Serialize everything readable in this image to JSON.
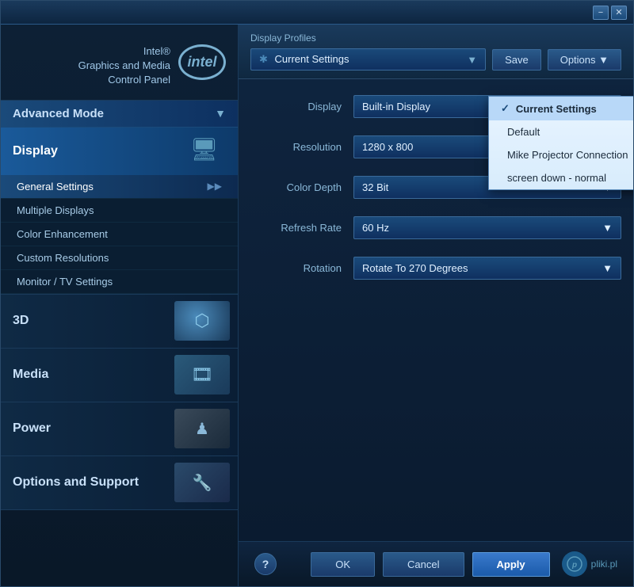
{
  "window": {
    "title": "Intel® Graphics and Media Control Panel",
    "min_btn": "−",
    "close_btn": "✕"
  },
  "sidebar": {
    "intel_label": "intel",
    "app_title_line1": "Intel®",
    "app_title_line2": "Graphics and Media",
    "app_title_line3": "Control Panel",
    "mode_label": "Advanced Mode",
    "mode_arrow": "▼",
    "sections": [
      {
        "id": "display",
        "label": "Display",
        "active": true,
        "sub_items": [
          {
            "label": "General Settings",
            "active": true,
            "has_arrow": true
          },
          {
            "label": "Multiple Displays"
          },
          {
            "label": "Color Enhancement"
          },
          {
            "label": "Custom Resolutions"
          },
          {
            "label": "Monitor / TV Settings"
          }
        ]
      },
      {
        "id": "3d",
        "label": "3D"
      },
      {
        "id": "media",
        "label": "Media"
      },
      {
        "id": "power",
        "label": "Power"
      },
      {
        "id": "options",
        "label": "Options and Support"
      }
    ]
  },
  "main": {
    "profiles_label": "Display Profiles",
    "profile_star": "✱",
    "profile_current": "Current Settings",
    "save_btn": "Save",
    "options_btn": "Options ▼",
    "dropdown": {
      "items": [
        {
          "label": "Current Settings",
          "checked": true
        },
        {
          "label": "Default",
          "grayed": false
        },
        {
          "label": "Mike Projector Connection",
          "grayed": false
        },
        {
          "label": "screen down - normal",
          "grayed": false
        }
      ]
    },
    "settings": [
      {
        "label": "Display",
        "value": "Built-in Display"
      },
      {
        "label": "Resolution",
        "value": "1280 x 800"
      },
      {
        "label": "Color Depth",
        "value": "32 Bit"
      },
      {
        "label": "Refresh Rate",
        "value": "60 Hz"
      },
      {
        "label": "Rotation",
        "value": "Rotate To 270 Degrees"
      }
    ]
  },
  "footer": {
    "help_label": "?",
    "ok_label": "OK",
    "cancel_label": "Cancel",
    "apply_label": "Apply",
    "brand_name": "pliki.pl"
  }
}
